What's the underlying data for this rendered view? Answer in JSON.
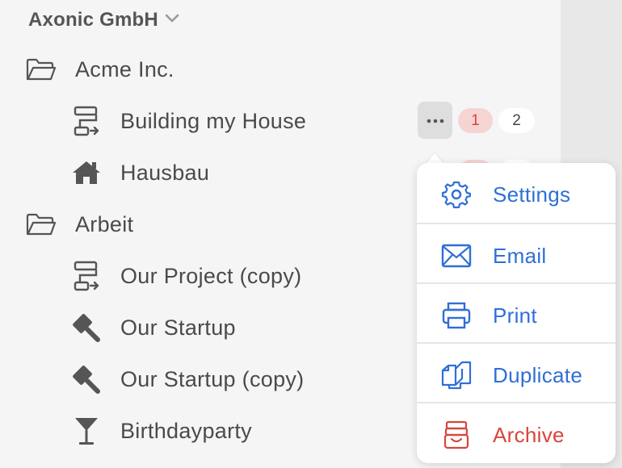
{
  "colors": {
    "accent": "#2f6fd6",
    "danger": "#d9443c",
    "text": "#4a4a4a",
    "sidebar_bg": "#f5f5f5"
  },
  "workspace": {
    "title": "Axonic GmbH",
    "icon": "chevron-down-icon"
  },
  "tree": {
    "folders": [
      {
        "label": "Acme Inc.",
        "icon": "folder-icon"
      },
      {
        "label": "Arbeit",
        "icon": "folder-icon"
      }
    ],
    "projects": [
      {
        "label": "Building my House",
        "icon": "flowchart-icon",
        "badge_red": "1",
        "badge_grey": "2"
      },
      {
        "label": "Hausbau",
        "icon": "house-icon"
      },
      {
        "label": "Our Project (copy)",
        "icon": "flowchart-icon"
      },
      {
        "label": "Our Startup",
        "icon": "gavel-icon"
      },
      {
        "label": "Our Startup (copy)",
        "icon": "gavel-icon"
      },
      {
        "label": "Birthdayparty",
        "icon": "cocktail-icon"
      }
    ]
  },
  "more_button": {
    "icon": "ellipsis-icon"
  },
  "menu": {
    "items": [
      {
        "label": "Settings",
        "icon": "gear-icon"
      },
      {
        "label": "Email",
        "icon": "envelope-icon"
      },
      {
        "label": "Print",
        "icon": "printer-icon"
      },
      {
        "label": "Duplicate",
        "icon": "duplicate-icon"
      },
      {
        "label": "Archive",
        "icon": "archive-icon"
      }
    ]
  }
}
